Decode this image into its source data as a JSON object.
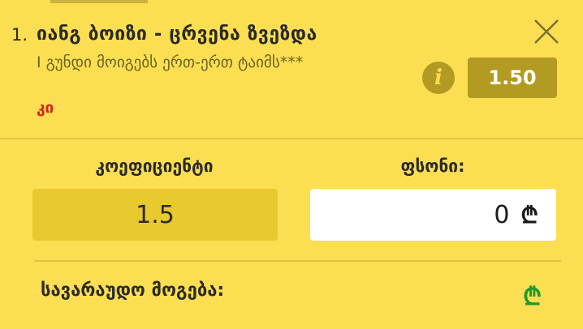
{
  "bet": {
    "index": "1.",
    "title": "იანგ ბოიზი - ცრვენა ზვეზდა",
    "market": "I გუნდი მოიგებს ერთ-ერთ ტაიმს***",
    "selection": "კი",
    "odds": "1.50",
    "info_symbol": "i",
    "close_symbol": "×"
  },
  "form": {
    "coefficient_label": "კოეფიციენტი",
    "coefficient_value": "1.5",
    "stake_label": "ფსონი:",
    "stake_value": "0",
    "currency_symbol": "₾"
  },
  "summary": {
    "potential_win_label": "სავარაუდო მოგება:",
    "potential_win_currency": "₾"
  },
  "colors": {
    "background": "#FCDE53",
    "badge": "#B39A22",
    "selection": "#D2261E",
    "win_currency": "#1E9A2B"
  }
}
